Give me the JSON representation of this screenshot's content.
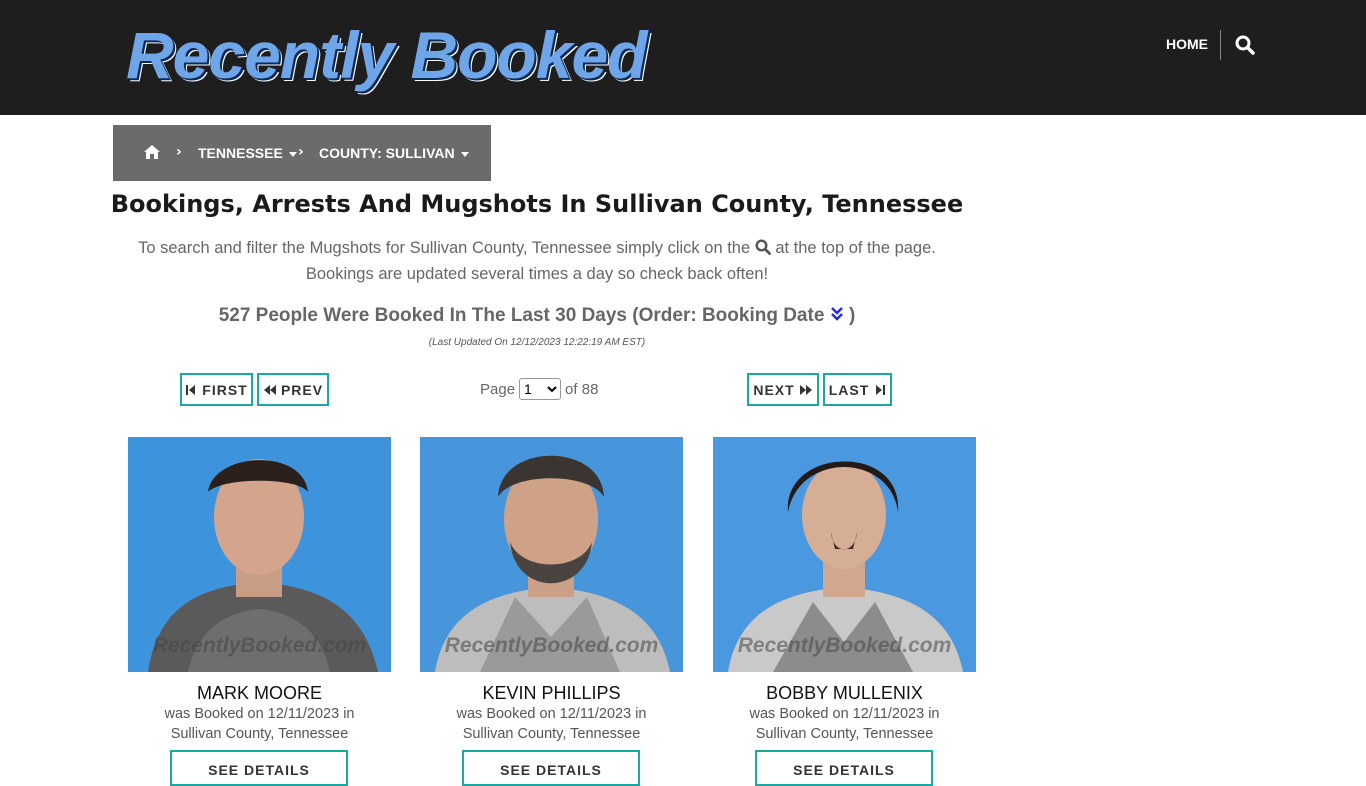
{
  "header": {
    "logo_text": "Recently Booked",
    "home_label": "HOME",
    "search_icon": "search-icon"
  },
  "breadcrumb": {
    "home_icon": "home-icon",
    "state": "TENNESSEE",
    "county": "COUNTY: SULLIVAN"
  },
  "main": {
    "title": "Bookings, Arrests And Mugshots In Sullivan County, Tennessee",
    "intro_line1_pre": "To search and filter the Mugshots for Sullivan County, Tennessee simply click on the",
    "intro_line1_post": "at the top of the page.",
    "intro_line2": "Bookings are updated several times a day so check back often!",
    "count_text": "527 People Were Booked In The Last 30 Days (Order: Booking Date",
    "count_close": ")",
    "last_updated": "(Last Updated On 12/12/2023 12:22:19 AM EST)"
  },
  "pagination": {
    "first": "FIRST",
    "prev": "PREV",
    "next": "NEXT",
    "last": "LAST",
    "page_label": "Page",
    "current_page": "1",
    "of_label": "of 88"
  },
  "cards": [
    {
      "name": "MARK MOORE",
      "line1": "was Booked on 12/11/2023 in",
      "line2": "Sullivan County, Tennessee",
      "watermark": "RecentlyBooked.com",
      "button": "SEE DETAILS"
    },
    {
      "name": "KEVIN PHILLIPS",
      "line1": "was Booked on 12/11/2023 in",
      "line2": "Sullivan County, Tennessee",
      "watermark": "RecentlyBooked.com",
      "button": "SEE DETAILS"
    },
    {
      "name": "BOBBY MULLENIX",
      "line1": "was Booked on 12/11/2023 in",
      "line2": "Sullivan County, Tennessee",
      "watermark": "RecentlyBooked.com",
      "button": "SEE DETAILS"
    }
  ],
  "colors": {
    "header_bg": "#1e1e1e",
    "breadcrumb_bg": "#6b6b6b",
    "accent": "#1aa99e",
    "sort_icon": "#2b2bd6"
  }
}
